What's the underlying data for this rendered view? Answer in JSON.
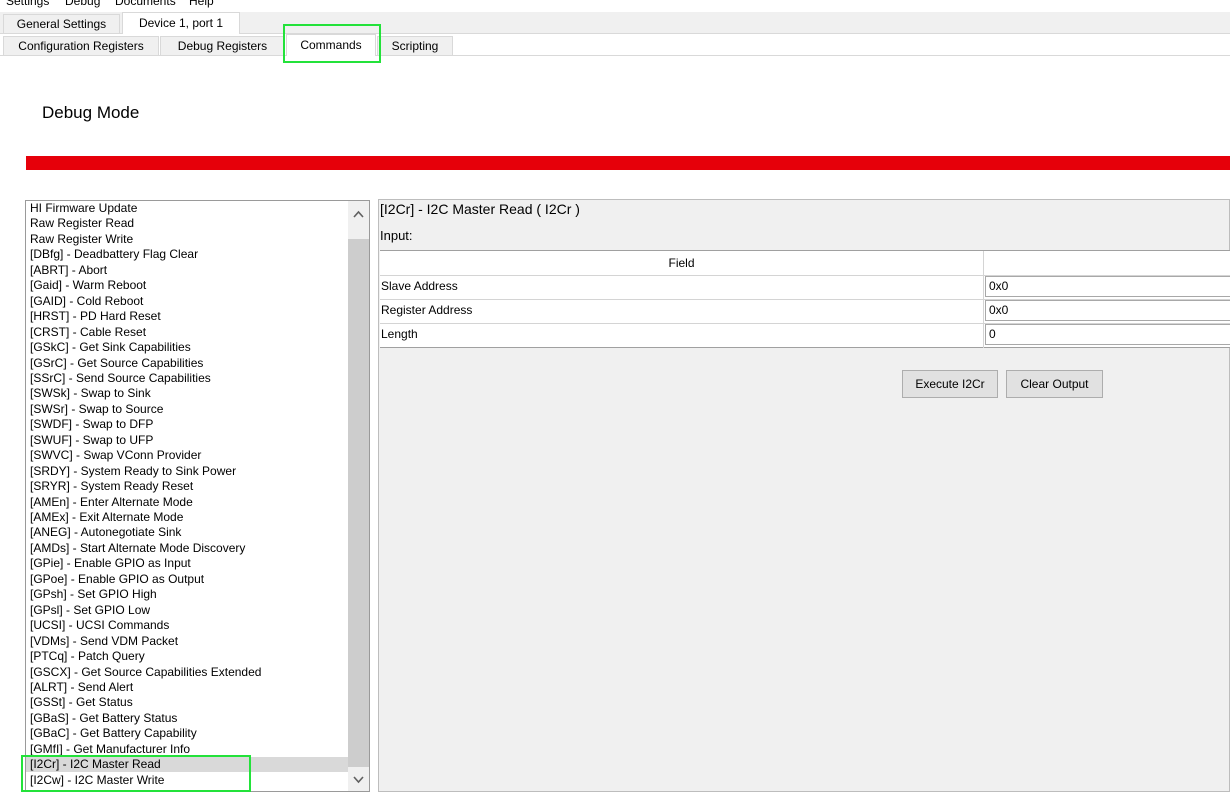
{
  "menu": [
    "Settings",
    "Debug",
    "Documents",
    "Help"
  ],
  "top_tabs": [
    "General Settings",
    "Device 1, port 1"
  ],
  "sub_tabs": [
    "Configuration Registers",
    "Debug Registers",
    "Commands",
    "Scripting"
  ],
  "page_title": "Debug Mode",
  "commands": [
    "HI Firmware Update",
    "Raw Register Read",
    "Raw Register Write",
    "[DBfg] - Deadbattery Flag Clear",
    "[ABRT] - Abort",
    "[Gaid] - Warm Reboot",
    "[GAID] - Cold Reboot",
    "[HRST] - PD Hard Reset",
    "[CRST] - Cable Reset",
    "[GSkC] - Get Sink Capabilities",
    "[GSrC] - Get Source Capabilities",
    "[SSrC] - Send Source Capabilities",
    "[SWSk] - Swap to Sink",
    "[SWSr] - Swap to Source",
    "[SWDF] - Swap to DFP",
    "[SWUF] - Swap to UFP",
    "[SWVC] - Swap VConn Provider",
    "[SRDY] - System Ready to Sink Power",
    "[SRYR] - System Ready Reset",
    "[AMEn] - Enter Alternate Mode",
    "[AMEx] - Exit Alternate Mode",
    "[ANEG] - Autonegotiate Sink",
    "[AMDs] - Start Alternate Mode Discovery",
    "[GPie] - Enable GPIO as Input",
    "[GPoe] - Enable GPIO as Output",
    "[GPsh] - Set GPIO High",
    "[GPsl] - Set GPIO Low",
    "[UCSI] - UCSI Commands",
    "[VDMs] - Send VDM Packet",
    "[PTCq] - Patch Query",
    "[GSCX] - Get Source Capabilities Extended",
    "[ALRT] - Send Alert",
    "[GSSt] - Get Status",
    "[GBaS] - Get Battery Status",
    "[GBaC] - Get Battery Capability",
    "[GMfI] - Get Manufacturer Info",
    "[I2Cr] - I2C Master Read",
    "[I2Cw] - I2C Master Write"
  ],
  "selected_command": "[I2Cr] - I2C Master Read",
  "panel": {
    "title": "[I2Cr] - I2C Master Read  ( I2Cr )",
    "input_label": "Input:",
    "field_header": "Field",
    "fields": [
      {
        "name": "Slave Address",
        "value": "0x0"
      },
      {
        "name": "Register Address",
        "value": "0x0"
      },
      {
        "name": "Length",
        "value": "0"
      }
    ],
    "execute_label": "Execute I2Cr",
    "clear_label": "Clear Output"
  },
  "icons": {
    "scroll_up": "chevron-up-icon",
    "scroll_down": "chevron-down-icon"
  },
  "colors": {
    "accent_bar": "#e6000a",
    "highlight": "#23e23a",
    "selected_row": "#d9d9d9"
  }
}
